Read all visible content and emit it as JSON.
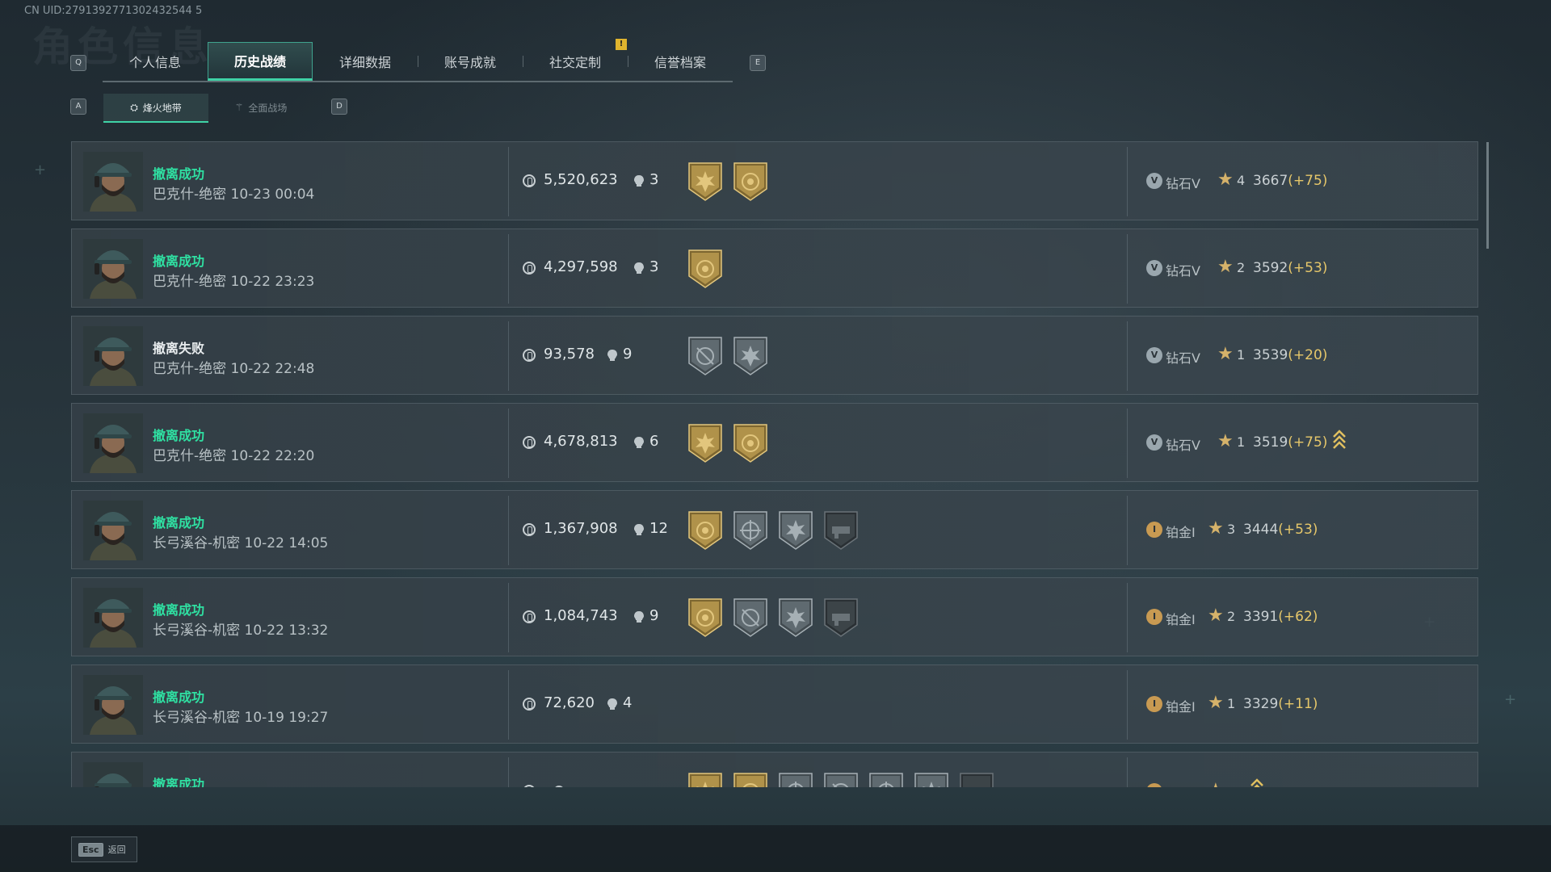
{
  "uid": "CN UID:2791392771302432544 5",
  "ghost_title": "角色信息",
  "keys": {
    "prev_tab": "Q",
    "next_tab": "E",
    "prev_sub": "A",
    "next_sub": "D"
  },
  "tabs": [
    {
      "label": "个人信息"
    },
    {
      "label": "历史战绩",
      "active": true
    },
    {
      "label": "详细数据"
    },
    {
      "label": "账号成就"
    },
    {
      "label": "社交定制"
    },
    {
      "label": "信誉档案"
    }
  ],
  "alert_badge": "!",
  "subtabs": [
    {
      "label": "烽火地带",
      "icon": "hazard-icon",
      "active": true
    },
    {
      "label": "全面战场",
      "icon": "warfare-icon"
    }
  ],
  "rows": [
    {
      "status": "撤离成功",
      "ok": true,
      "detail": "巴克什-绝密 10-23 00:04",
      "value": "5,520,623",
      "kills": "3",
      "medals": [
        "gold-burst",
        "gold-coin"
      ],
      "rank_icon": "V",
      "rank_class": "dia",
      "rank": "钻石V",
      "stars": "4",
      "score": "3667",
      "delta": "(+75)",
      "chevron": false
    },
    {
      "status": "撤离成功",
      "ok": true,
      "detail": "巴克什-绝密 10-22 23:23",
      "value": "4,297,598",
      "kills": "3",
      "medals": [
        "gold-coin"
      ],
      "rank_icon": "V",
      "rank_class": "dia",
      "rank": "钻石V",
      "stars": "2",
      "score": "3592",
      "delta": "(+53)",
      "chevron": false
    },
    {
      "status": "撤离失败",
      "ok": false,
      "detail": "巴克什-绝密 10-22 22:48",
      "value": "93,578",
      "kills": "9",
      "medals": [
        "silver-crosshair",
        "silver-burst"
      ],
      "rank_icon": "V",
      "rank_class": "dia",
      "rank": "钻石V",
      "stars": "1",
      "score": "3539",
      "delta": "(+20)",
      "chevron": false
    },
    {
      "status": "撤离成功",
      "ok": true,
      "detail": "巴克什-绝密 10-22 22:20",
      "value": "4,678,813",
      "kills": "6",
      "medals": [
        "gold-burst",
        "gold-coin"
      ],
      "rank_icon": "V",
      "rank_class": "dia",
      "rank": "钻石V",
      "stars": "1",
      "score": "3519",
      "delta": "(+75)",
      "chevron": true
    },
    {
      "status": "撤离成功",
      "ok": true,
      "detail": "长弓溪谷-机密 10-22 14:05",
      "value": "1,367,908",
      "kills": "12",
      "medals": [
        "gold-coin",
        "silver-target",
        "silver-burst",
        "dark-gun"
      ],
      "rank_icon": "I",
      "rank_class": "plat",
      "rank": "铂金I",
      "stars": "3",
      "score": "3444",
      "delta": "(+53)",
      "chevron": false
    },
    {
      "status": "撤离成功",
      "ok": true,
      "detail": "长弓溪谷-机密 10-22 13:32",
      "value": "1,084,743",
      "kills": "9",
      "medals": [
        "gold-coin",
        "silver-crosshair",
        "silver-burst",
        "dark-gun"
      ],
      "rank_icon": "I",
      "rank_class": "plat",
      "rank": "铂金I",
      "stars": "2",
      "score": "3391",
      "delta": "(+62)",
      "chevron": false
    },
    {
      "status": "撤离成功",
      "ok": true,
      "detail": "长弓溪谷-机密 10-19 19:27",
      "value": "72,620",
      "kills": "4",
      "medals": [],
      "rank_icon": "I",
      "rank_class": "plat",
      "rank": "铂金I",
      "stars": "1",
      "score": "3329",
      "delta": "(+11)",
      "chevron": false
    },
    {
      "status": "撤离成功",
      "ok": true,
      "detail": "",
      "value": "",
      "kills": "",
      "medals": [
        "gold-burst",
        "gold-coin",
        "silver-target",
        "silver-crosshair",
        "silver-target",
        "silver-burst",
        "dark-gun"
      ],
      "rank_icon": "I",
      "rank_class": "plat",
      "rank": "",
      "stars": "",
      "score": "",
      "delta": "",
      "chevron": true
    }
  ],
  "back": {
    "key": "Esc",
    "label": "返回"
  },
  "colors": {
    "success": "#2fe0a2",
    "accent": "#3fd2a6",
    "gold": "#c9a85a",
    "delta": "#e6c76a"
  }
}
